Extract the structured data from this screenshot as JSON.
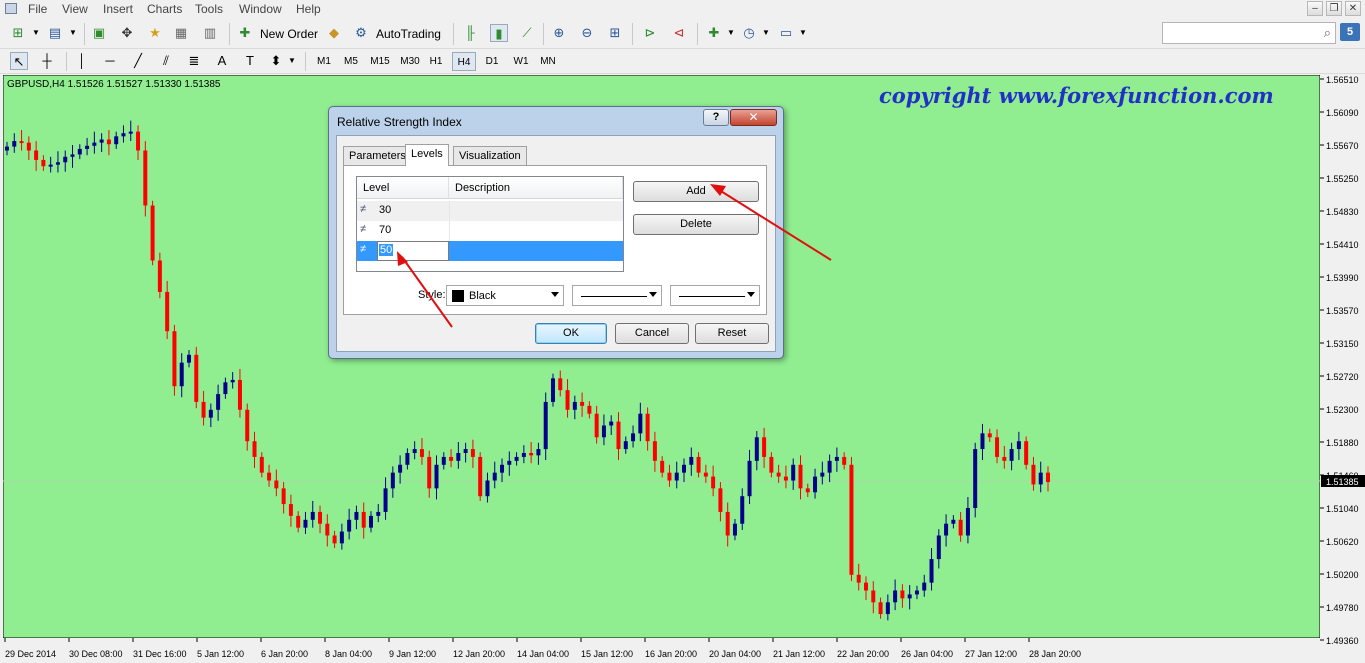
{
  "menu": {
    "items": [
      "File",
      "View",
      "Insert",
      "Charts",
      "Tools",
      "Window",
      "Help"
    ]
  },
  "toolbar": {
    "new_order": "New Order",
    "auto_trading": "AutoTrading",
    "timeframes": [
      "M1",
      "M5",
      "M15",
      "M30",
      "H1",
      "H4",
      "D1",
      "W1",
      "MN"
    ],
    "active_timeframe": "H4",
    "notification_count": "5"
  },
  "chart": {
    "symbol_info": "GBPUSD,H4  1.51526 1.51527 1.51330 1.51385",
    "watermark": "copyright www.forexfunction.com",
    "background": "#90ee90",
    "bull_color": "#00008b",
    "bear_color": "#ff0000",
    "current_price": "1.51385",
    "price_labels": [
      "1.56510",
      "1.56090",
      "1.55670",
      "1.55250",
      "1.54830",
      "1.54410",
      "1.53990",
      "1.53570",
      "1.53150",
      "1.52720",
      "1.52300",
      "1.51880",
      "1.51460",
      "1.51040",
      "1.50620",
      "1.50200",
      "1.49780",
      "1.49360"
    ],
    "time_labels": [
      "29 Dec 2014",
      "30 Dec 08:00",
      "31 Dec 16:00",
      "5 Jan 12:00",
      "6 Jan 20:00",
      "8 Jan 04:00",
      "9 Jan 12:00",
      "12 Jan 20:00",
      "14 Jan 04:00",
      "15 Jan 12:00",
      "16 Jan 20:00",
      "20 Jan 04:00",
      "21 Jan 12:00",
      "22 Jan 20:00",
      "26 Jan 04:00",
      "27 Jan 12:00",
      "28 Jan 20:00"
    ]
  },
  "dialog": {
    "title": "Relative Strength Index",
    "help": "?",
    "close": "✕",
    "tabs": [
      "Parameters",
      "Levels",
      "Visualization"
    ],
    "active_tab": "Levels",
    "columns": [
      "Level",
      "Description"
    ],
    "levels": [
      "30",
      "70",
      "50"
    ],
    "selected_level": "50",
    "add_button": "Add",
    "delete_button": "Delete",
    "style_label": "Style:",
    "style_color": "Black",
    "ok_button": "OK",
    "cancel_button": "Cancel",
    "reset_button": "Reset"
  }
}
